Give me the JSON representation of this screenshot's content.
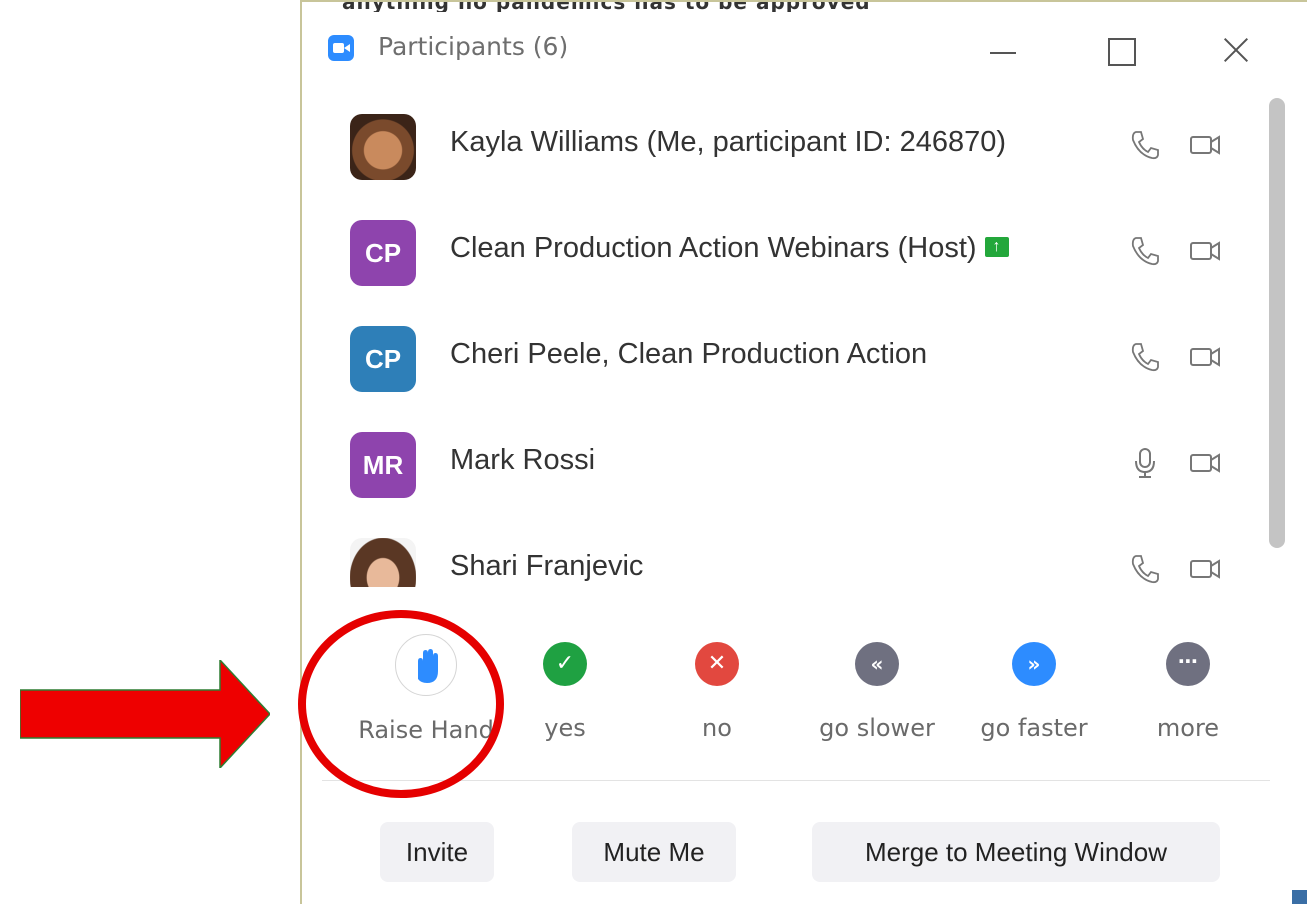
{
  "window": {
    "top_strip_text": "anything no pandemics has to be approved",
    "title": "Participants (6)",
    "controls": {
      "minimize": "minimize-icon",
      "maximize": "maximize-icon",
      "close": "close-icon"
    }
  },
  "participants": [
    {
      "initials": "",
      "name": "Kayla Williams (Me, participant ID: 246870)",
      "audio": "phone-icon",
      "video": "video-off-icon",
      "avatar_type": "photo"
    },
    {
      "initials": "CP",
      "name": "Clean Production Action Webinars (Host)",
      "audio": "phone-icon",
      "video": "video-off-icon",
      "avatar_color": "#8e44ad",
      "sharing": true
    },
    {
      "initials": "CP",
      "name": "Cheri Peele, Clean Production Action",
      "audio": "phone-icon",
      "video": "video-off-icon",
      "avatar_color": "#2e7fb8"
    },
    {
      "initials": "MR",
      "name": "Mark Rossi",
      "audio": "microphone-icon",
      "video": "video-off-icon",
      "avatar_color": "#8e44ad"
    },
    {
      "initials": "",
      "name": "Shari Franjevic",
      "audio": "phone-icon",
      "video": "video-off-icon",
      "avatar_type": "photo"
    }
  ],
  "reactions": [
    {
      "label": "Raise Hand",
      "icon": "raise-hand-icon",
      "color": "#2d8cff"
    },
    {
      "label": "yes",
      "icon": "checkmark-icon",
      "color": "#1fa142"
    },
    {
      "label": "no",
      "icon": "x-icon",
      "color": "#e2483f"
    },
    {
      "label": "go slower",
      "icon": "rewind-icon",
      "color": "#6f7080"
    },
    {
      "label": "go faster",
      "icon": "fast-forward-icon",
      "color": "#2d8cff"
    },
    {
      "label": "more",
      "icon": "ellipsis-icon",
      "color": "#6f7080"
    }
  ],
  "buttons": {
    "invite": "Invite",
    "mute_me": "Mute Me",
    "merge": "Merge to Meeting Window"
  },
  "annotations": {
    "arrow_color": "#ee0000",
    "circle_color": "#e50000"
  }
}
